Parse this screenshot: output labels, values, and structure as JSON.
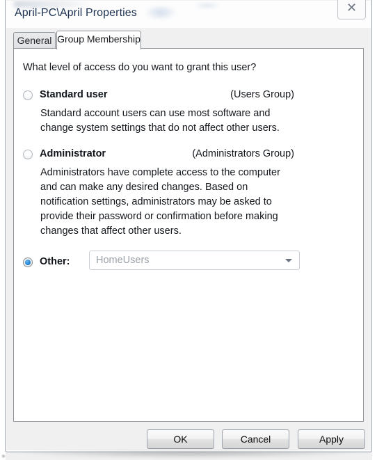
{
  "window": {
    "title": "April-PC\\April Properties",
    "close_icon": "close-x-icon",
    "close_glyph": "✕"
  },
  "tabs": [
    {
      "label": "General",
      "active": false
    },
    {
      "label": "Group Membership",
      "active": true
    }
  ],
  "panel": {
    "question": "What level of access do you want to grant this user?",
    "options": [
      {
        "id": "standard-user",
        "label": "Standard user",
        "group": "(Users Group)",
        "selected": false,
        "description": "Standard account users can use most software and change system settings that do not affect other users."
      },
      {
        "id": "administrator",
        "label": "Administrator",
        "group": "(Administrators Group)",
        "selected": false,
        "description": "Administrators have complete access to the computer and can make any desired changes. Based on notification settings, administrators may be asked to provide their password or confirmation before making changes that affect other users."
      },
      {
        "id": "other",
        "label": "Other:",
        "group": "",
        "selected": true,
        "description": ""
      }
    ],
    "other_combo": {
      "value": "HomeUsers",
      "disabled": true,
      "arrow_icon": "chevron-down-icon"
    }
  },
  "footer": {
    "ok_label": "OK",
    "cancel_label": "Cancel",
    "apply_label": "Apply"
  },
  "colors": {
    "accent_radio": "#2487d4",
    "title_text": "#1d3252",
    "body_text": "#14181d",
    "disabled_text": "#9aa0a8",
    "dialog_bg": "#f0f0f0",
    "panel_bg": "#ffffff",
    "border": "#8d9299"
  }
}
